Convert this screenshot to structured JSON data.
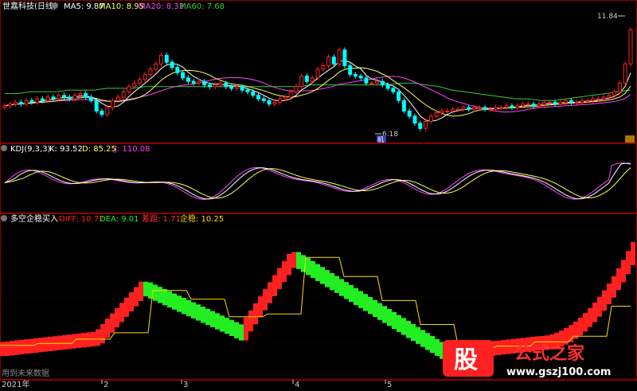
{
  "header": {
    "stock_name": "世嘉科技(日线)",
    "ma5": "MA5: 9.87",
    "ma10": "MA10: 8.95",
    "ma20": "MA20: 8.32",
    "ma60": "MA60: 7.68",
    "price_high": "11.84",
    "price_low": "6.18",
    "low_tag": "机"
  },
  "kdj": {
    "label": "KDJ(9,3,3)",
    "k": "K: 93.52",
    "d": "D: 85.25",
    "j": "J: 110.08"
  },
  "indicator": {
    "label": "多空企稳买入",
    "diff": "DIFF: 10.72",
    "dea": "DEA: 9.01",
    "gap": "差距: 1.71",
    "stable": "企稳: 10.25",
    "footer_note": "用到未来数据"
  },
  "axis": {
    "ticks": [
      "2021年",
      "2",
      "3",
      "4",
      "5"
    ]
  },
  "watermark": {
    "glyph": "股",
    "site_name": "公式之家",
    "url": "www.gszj100.com"
  },
  "colors": {
    "bg": "#000000",
    "frame": "#8b0000",
    "up": "#ff2020",
    "down": "#22ee22",
    "ma5": "#ffffff",
    "ma10": "#ffff55",
    "ma20": "#ff44ff",
    "ma60": "#33cc33",
    "candle_down": "#00ffff",
    "stable_line": "#ffdd00"
  },
  "chart_data": {
    "type": "line",
    "title": "世嘉科技(日线)",
    "panels": [
      "price",
      "KDJ(9,3,3)",
      "多空企稳买入"
    ],
    "price_range": [
      6.18,
      11.84
    ],
    "price_series": {
      "close": [
        7.5,
        7.6,
        7.7,
        7.6,
        7.8,
        7.7,
        7.9,
        7.8,
        8.0,
        7.9,
        8.1,
        8.0,
        7.9,
        8.1,
        8.2,
        8.0,
        7.8,
        7.2,
        7.0,
        7.4,
        7.8,
        8.0,
        8.3,
        8.6,
        8.8,
        9.0,
        9.3,
        9.6,
        9.9,
        10.4,
        10.0,
        9.7,
        9.4,
        9.1,
        8.9,
        8.8,
        8.9,
        8.7,
        8.6,
        8.7,
        8.8,
        8.6,
        8.5,
        8.6,
        8.4,
        8.3,
        8.1,
        7.9,
        7.8,
        7.6,
        7.7,
        7.9,
        8.0,
        8.3,
        8.6,
        9.2,
        8.9,
        9.1,
        9.6,
        9.8,
        10.3,
        9.9,
        10.7,
        9.8,
        9.3,
        9.2,
        9.1,
        8.8,
        8.8,
        8.9,
        8.7,
        8.5,
        8.3,
        7.8,
        7.2,
        6.9,
        6.5,
        6.2,
        6.6,
        6.9,
        7.1,
        7.2,
        7.2,
        7.3,
        7.3,
        7.4,
        7.3,
        7.4,
        7.4,
        7.3,
        7.3,
        7.4,
        7.4,
        7.5,
        7.4,
        7.5,
        7.6,
        7.6,
        7.5,
        7.6,
        7.7,
        7.7,
        7.6,
        7.7,
        7.8,
        7.7,
        7.7,
        7.8,
        7.8,
        7.9,
        7.9,
        8.0,
        8.1,
        8.3,
        8.8,
        9.9,
        11.84
      ],
      "ma60": [
        8.2,
        8.2,
        8.3,
        8.3,
        8.3,
        8.4,
        8.4,
        8.4,
        8.5,
        8.5,
        8.5,
        8.6,
        8.6,
        8.6,
        8.6,
        8.6,
        8.6,
        8.6,
        8.6,
        8.6,
        8.6,
        8.6,
        8.6,
        8.6,
        8.7,
        8.7,
        8.7,
        8.7,
        8.7,
        8.7,
        8.7,
        8.8,
        8.8,
        8.7,
        8.6,
        8.4,
        8.3,
        8.2,
        8.1,
        8.0,
        7.9,
        7.9,
        7.8,
        7.8,
        7.9,
        8.0,
        8.1,
        8.2,
        8.3,
        8.4
      ]
    },
    "kdj_values": {
      "K": 93.52,
      "D": 85.25,
      "J": 110.08
    },
    "macd_values": {
      "DIFF": 10.72,
      "DEA": 9.01,
      "gap": 1.71,
      "stable": 10.25
    },
    "x_ticks": [
      "2021年",
      "2",
      "3",
      "4",
      "5"
    ],
    "grid": false
  }
}
